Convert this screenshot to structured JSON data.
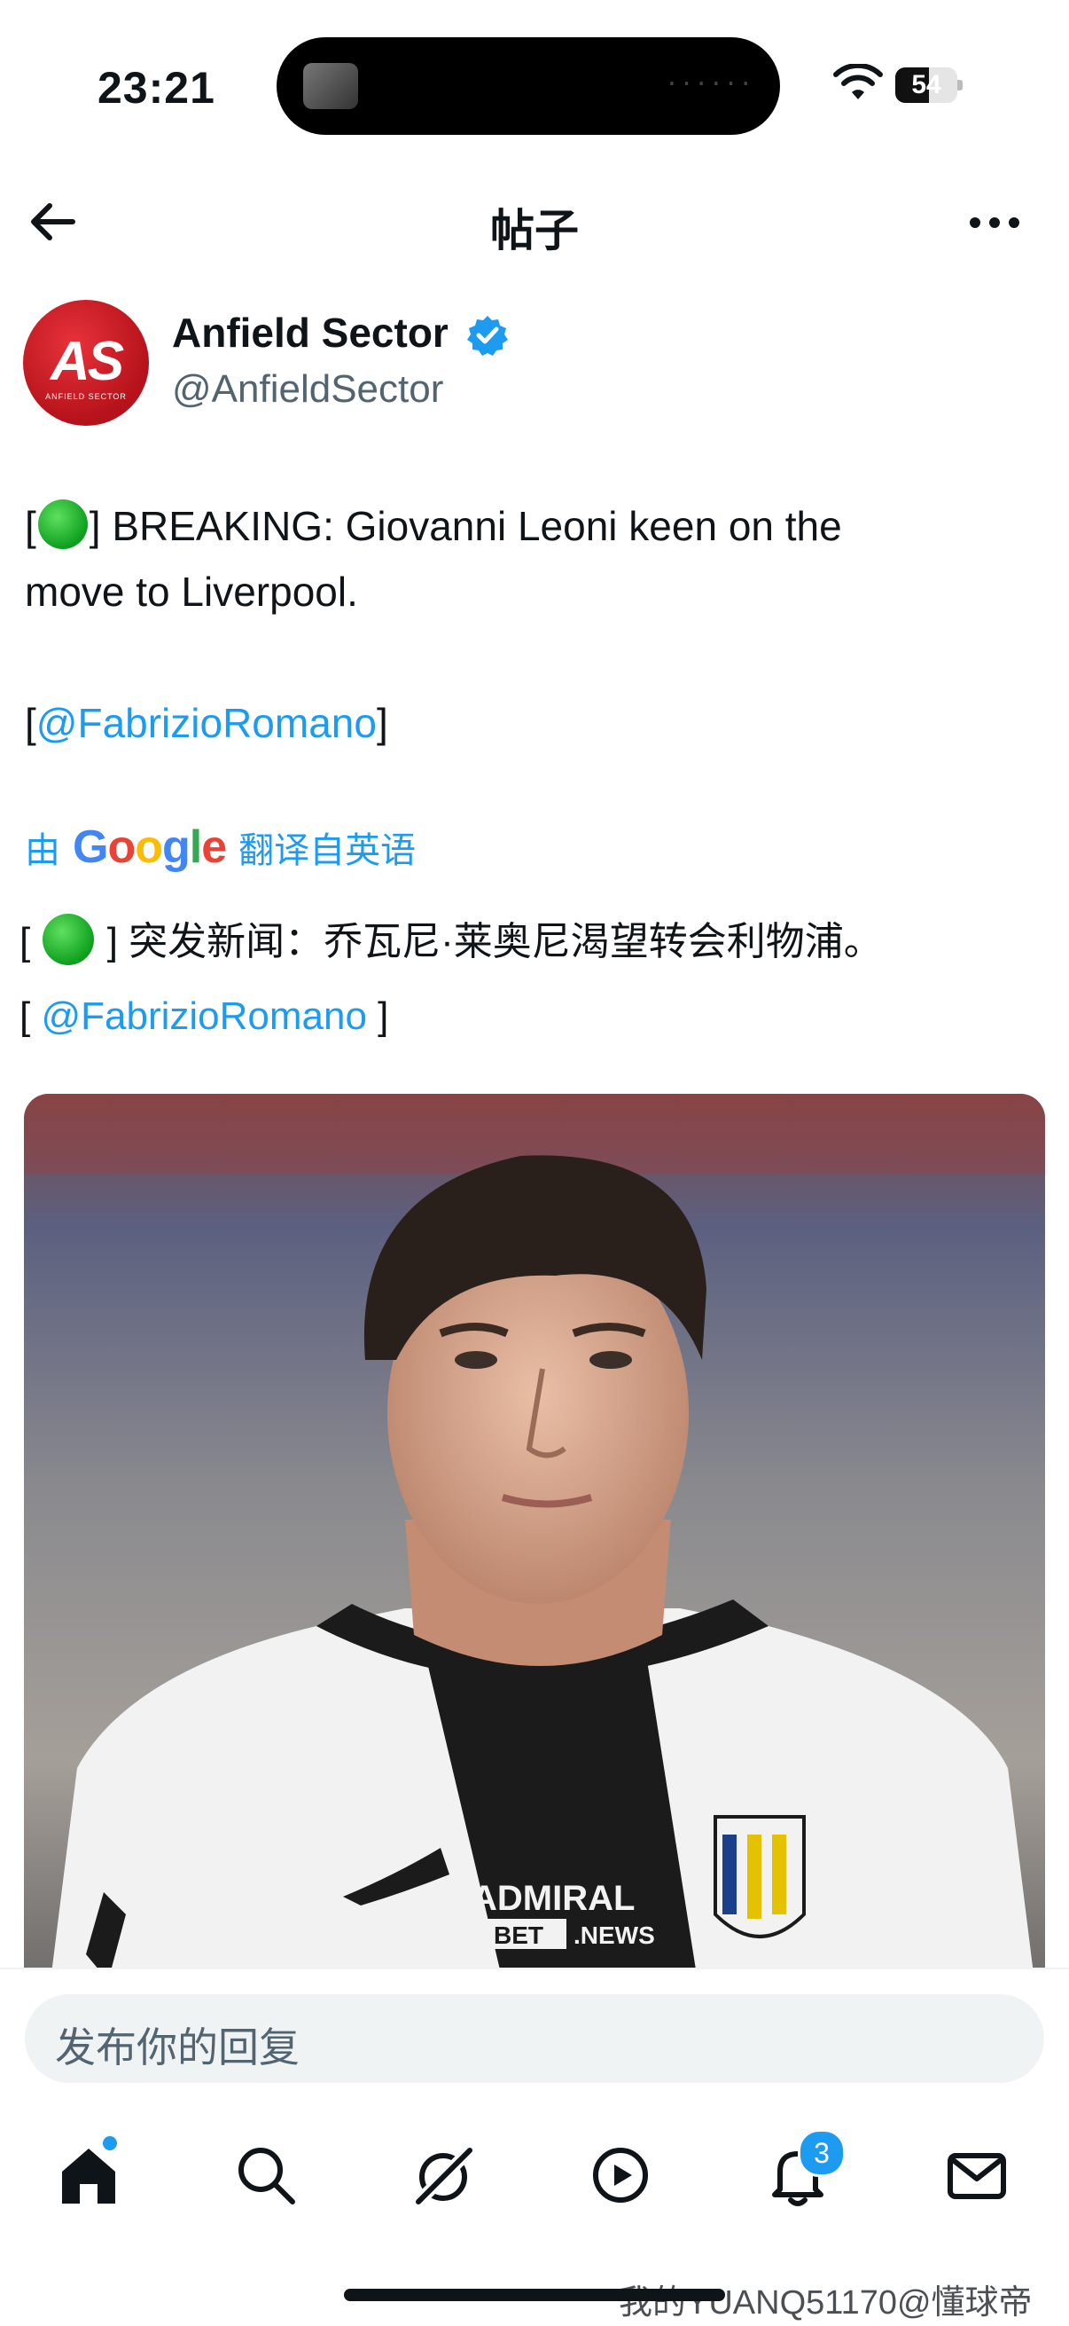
{
  "status_bar": {
    "time": "23:21",
    "battery": "54",
    "battery_level": 0.54,
    "island_dots": "······"
  },
  "header": {
    "title": "帖子",
    "back_icon": "arrow-left-icon",
    "more_icon": "more-horizontal-icon"
  },
  "author": {
    "avatar_text": "AS",
    "avatar_subtext": "ANFIELD SECTOR",
    "name": "Anfield Sector",
    "handle": "@AnfieldSector",
    "verified": true
  },
  "post": {
    "line1_prefix": "[",
    "line1_text": "] BREAKING: Giovanni Leoni keen on the",
    "line2_text": "move to Liverpool.",
    "mention_open": "[",
    "mention": "@FabrizioRomano",
    "mention_close": "]"
  },
  "translation": {
    "prefix": "由",
    "google_logo": [
      "G",
      "o",
      "o",
      "g",
      "l",
      "e"
    ],
    "suffix": "翻译自英语",
    "line1_prefix": "[",
    "line1_text": "] 突发新闻：乔瓦尼·莱奥尼渴望转会利物浦。",
    "line2_open": "[",
    "line2_mention": "@FabrizioRomano",
    "line2_close": "]"
  },
  "image": {
    "sponsor_line1": "ADMIRAL",
    "sponsor_line2": "BET",
    "sponsor_line3": ".NEWS"
  },
  "reply": {
    "placeholder": "发布你的回复"
  },
  "tabs": [
    {
      "icon": "home-icon",
      "active": true
    },
    {
      "icon": "search-icon"
    },
    {
      "icon": "grok-icon"
    },
    {
      "icon": "video-icon"
    },
    {
      "icon": "notifications-icon",
      "badge": "3"
    },
    {
      "icon": "messages-icon"
    }
  ],
  "watermark": "我的YUANQ51170@懂球帝",
  "colors": {
    "accent": "#1d9bf0",
    "text": "#0f1419",
    "muted": "#536471"
  }
}
